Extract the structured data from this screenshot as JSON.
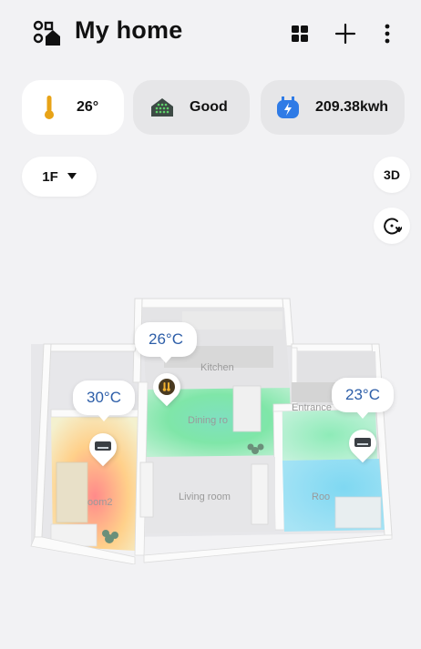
{
  "header": {
    "title": "My home"
  },
  "status_chips": [
    {
      "label": "26°",
      "icon": "thermometer-icon"
    },
    {
      "label": "Good",
      "icon": "air-quality-icon"
    },
    {
      "label": "209.38kwh",
      "icon": "energy-icon"
    }
  ],
  "floor_selector": {
    "value": "1F"
  },
  "view_toggle": {
    "label": "3D"
  },
  "floorplan": {
    "rooms": {
      "kitchen": "Kitchen",
      "dining": "Dining ro",
      "entrance": "Entrance",
      "living": "Living room",
      "room2": "oom2",
      "room3": "Roo"
    },
    "sensors": [
      {
        "temp": "26°C"
      },
      {
        "temp": "30°C"
      },
      {
        "temp": "23°C"
      }
    ]
  },
  "colors": {
    "accent": "#2d5ea8",
    "energy": "#2f7be6",
    "thermo": "#e8a317"
  }
}
